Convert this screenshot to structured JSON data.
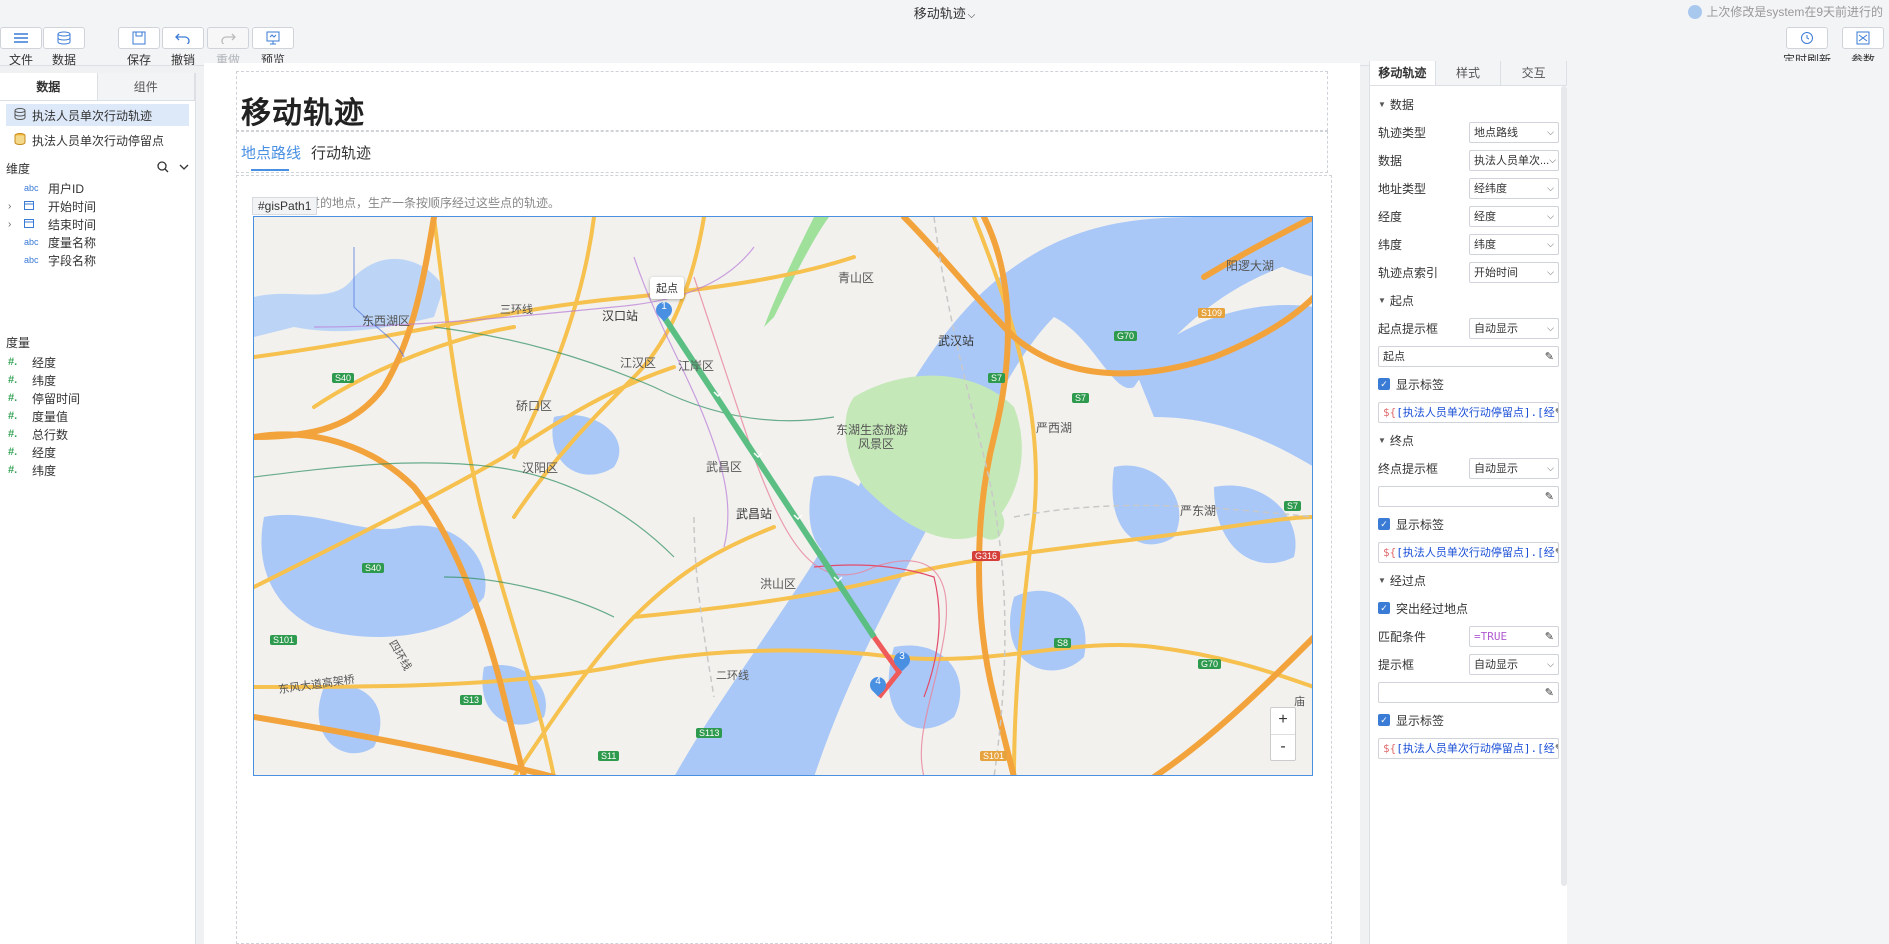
{
  "header": {
    "doc_title": "移动轨迹",
    "modified_note": "上次修改是system在9天前进行的"
  },
  "toolbar": {
    "file": "文件",
    "data": "数据",
    "save": "保存",
    "undo": "撤销",
    "redo": "重做",
    "preview": "预览",
    "timed_refresh": "定时刷新",
    "params": "参数"
  },
  "left_panel": {
    "tabs": [
      "数据",
      "组件"
    ],
    "datasets": [
      "执法人员单次行动轨迹",
      "执法人员单次行动停留点"
    ],
    "dimension_title": "维度",
    "dimensions": [
      {
        "type": "abc",
        "label": "用户ID"
      },
      {
        "type": "date",
        "label": "开始时间"
      },
      {
        "type": "date",
        "label": "结束时间"
      },
      {
        "type": "abc",
        "label": "度量名称"
      },
      {
        "type": "abc",
        "label": "字段名称"
      }
    ],
    "measure_title": "度量",
    "measures": [
      "经度",
      "纬度",
      "停留时间",
      "度量值",
      "总行数",
      "经度",
      "纬度"
    ]
  },
  "canvas": {
    "title": "移动轨迹",
    "tabs": [
      "地点路线",
      "行动轨迹"
    ],
    "component_id": "#gisPath1",
    "description": "过的地点，生产一条按顺序经过这些点的轨迹。",
    "map": {
      "start_label": "起点",
      "markers": [
        "1",
        "3",
        "4"
      ],
      "places": [
        {
          "name": "东西湖区"
        },
        {
          "name": "汉口站"
        },
        {
          "name": "江汉区"
        },
        {
          "name": "江岸区"
        },
        {
          "name": "硚口区"
        },
        {
          "name": "汉阳区"
        },
        {
          "name": "武昌区"
        },
        {
          "name": "武昌站"
        },
        {
          "name": "洪山区"
        },
        {
          "name": "青山区"
        },
        {
          "name": "武汉站"
        },
        {
          "name": "东湖生态旅游"
        },
        {
          "name": "风景区"
        },
        {
          "name": "严西湖"
        },
        {
          "name": "严东湖"
        },
        {
          "name": "阳逻大湖"
        },
        {
          "name": "东风大道高架桥"
        },
        {
          "name": "三环线"
        },
        {
          "name": "二环线"
        },
        {
          "name": "四环线"
        },
        {
          "name": "庙"
        }
      ],
      "road_badges": [
        "S40",
        "S40",
        "S101",
        "S13",
        "S11",
        "S113",
        "S7",
        "S7",
        "S7",
        "G70",
        "G70",
        "S109",
        "G316",
        "S8",
        "S101"
      ],
      "zoom_in": "+",
      "zoom_out": "-"
    }
  },
  "right_panel": {
    "tabs": [
      "移动轨迹",
      "样式",
      "交互"
    ],
    "group_data": "数据",
    "rows_data": [
      {
        "label": "轨迹类型",
        "value": "地点路线"
      },
      {
        "label": "数据",
        "value": "执法人员单次..."
      },
      {
        "label": "地址类型",
        "value": "经纬度"
      },
      {
        "label": "经度",
        "value": "经度"
      },
      {
        "label": "纬度",
        "value": "纬度"
      },
      {
        "label": "轨迹点索引",
        "value": "开始时间"
      }
    ],
    "group_start": "起点",
    "start_tip_label": "起点提示框",
    "start_tip_value": "自动显示",
    "start_text": "起点",
    "show_label": "显示标签",
    "label_expr": "[执法人员单次行动停留点].[经",
    "group_end": "终点",
    "end_tip_label": "终点提示框",
    "end_tip_value": "自动显示",
    "group_via": "经过点",
    "highlight_via": "突出经过地点",
    "match_label": "匹配条件",
    "match_value": "=TRUE",
    "tip_label": "提示框",
    "tip_value": "自动显示"
  },
  "colors": {
    "accent": "#4a90e2",
    "route_green": "#5bbf83",
    "route_red": "#ef5a5a",
    "water": "#a9c8f7",
    "park": "#c5e8b9"
  }
}
